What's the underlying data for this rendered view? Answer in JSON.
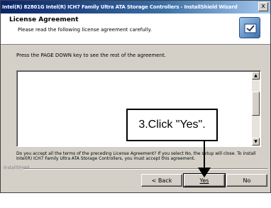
{
  "window": {
    "title": "Intel(R) 82801G Intel(R) ICH7 Family Ultra ATA Storage Controllers - InstallShield Wizard",
    "close_label": "x"
  },
  "header": {
    "title": "License Agreement",
    "subtitle": "Please read the following license agreement carefully.",
    "icon": "installer-icon"
  },
  "body": {
    "prompt": "Press the PAGE DOWN key to see the rest of the agreement.",
    "license_text": "",
    "question": "Do you accept all the terms of the preceding License Agreement? If you select No, the setup will close. To install Intel(R) ICH7 Family Ultra ATA Storage Controllers, you must accept this agreement."
  },
  "footer": {
    "brand": "InstallShield",
    "back_label": "< Back",
    "yes_label": "Yes",
    "no_label": "No"
  },
  "annotation": {
    "callout_text": "3.Click \"Yes\"."
  }
}
